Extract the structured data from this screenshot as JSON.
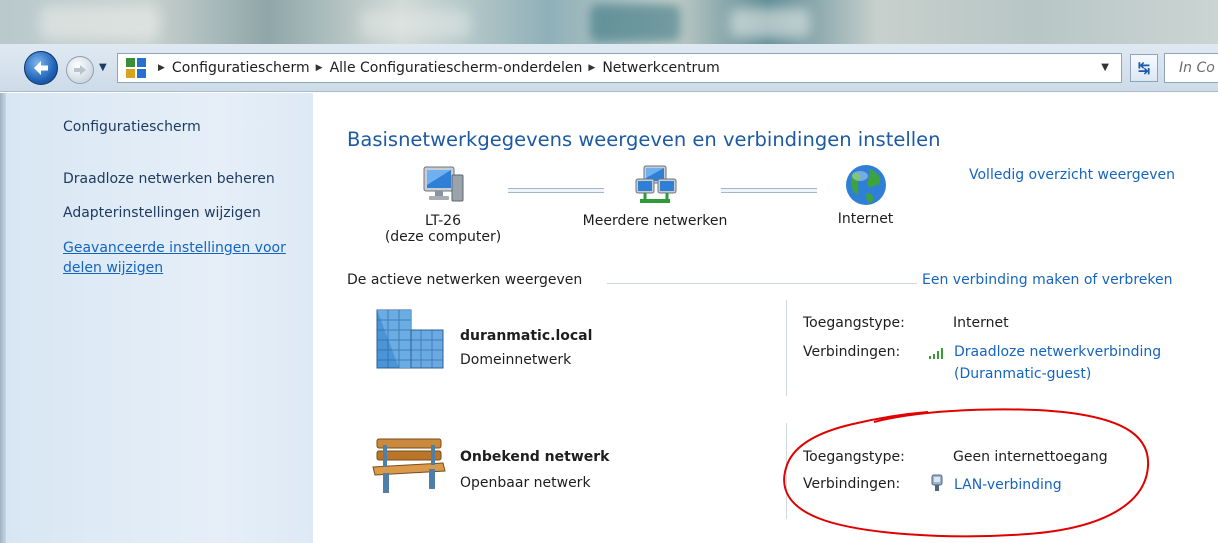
{
  "window": {
    "breadcrumbs": [
      "Configuratiescherm",
      "Alle Configuratiescherm-onderdelen",
      "Netwerkcentrum"
    ],
    "search_placeholder": "In Co"
  },
  "sidebar": {
    "home": "Configuratiescherm",
    "items": [
      {
        "label": "Draadloze netwerken beheren"
      },
      {
        "label": "Adapterinstellingen wijzigen"
      },
      {
        "label": "Geavanceerde instellingen voor delen wijzigen"
      }
    ]
  },
  "main": {
    "title": "Basisnetwerkgegevens weergeven en verbindingen instellen",
    "full_overview_link": "Volledig overzicht weergeven",
    "map": {
      "computer_name": "LT-26",
      "computer_sub": "(deze computer)",
      "multiple": "Meerdere netwerken",
      "internet": "Internet"
    },
    "active_header": "De actieve netwerken weergeven",
    "make_connection_link": "Een verbinding maken of verbreken",
    "networks": [
      {
        "name": "duranmatic.local",
        "type": "Domeinnetwerk",
        "access_label": "Toegangstype:",
        "access_value": "Internet",
        "conn_label": "Verbindingen:",
        "conn_link_line1": "Draadloze netwerkverbinding",
        "conn_link_line2": "(Duranmatic-guest)"
      },
      {
        "name": "Onbekend netwerk",
        "type": "Openbaar netwerk",
        "access_label": "Toegangstype:",
        "access_value": "Geen internettoegang",
        "conn_label": "Verbindingen:",
        "conn_link_line1": "LAN-verbinding"
      }
    ]
  },
  "colors": {
    "link": "#1565c0",
    "title": "#1d5aa3",
    "annotation": "#e00000"
  }
}
